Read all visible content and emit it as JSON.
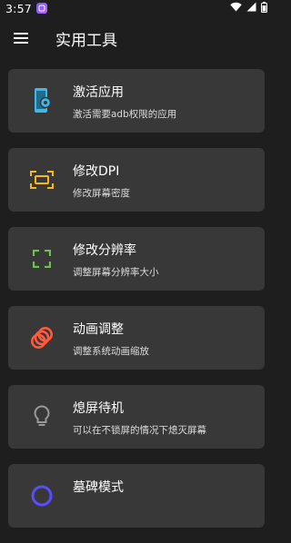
{
  "status_bar": {
    "time": "3:57",
    "icons": [
      "app-notification-icon",
      "wifi-icon",
      "cellular-signal-icon",
      "battery-icon"
    ]
  },
  "app_bar": {
    "menu_icon": "menu-icon",
    "title": "实用工具"
  },
  "tools": [
    {
      "icon": "phone-settings-icon",
      "icon_color": "#3fb8e8",
      "title": "激活应用",
      "subtitle": "激活需要adb权限的应用"
    },
    {
      "icon": "dpi-icon",
      "icon_color": "#f2b81c",
      "title": "修改DPI",
      "subtitle": "修改屏幕密度"
    },
    {
      "icon": "resolution-icon",
      "icon_color": "#6cc24a",
      "title": "修改分辨率",
      "subtitle": "调整屏幕分辨率大小"
    },
    {
      "icon": "animation-icon",
      "icon_color": "#ff5a3c",
      "title": "动画调整",
      "subtitle": "调整系统动画缩放"
    },
    {
      "icon": "lightbulb-icon",
      "icon_color": "#9a9a9a",
      "title": "熄屏待机",
      "subtitle": "可以在不锁屏的情况下熄灭屏幕"
    },
    {
      "icon": "tombstone-icon",
      "icon_color": "#5a4cff",
      "title": "墓碑模式",
      "subtitle": ""
    }
  ]
}
